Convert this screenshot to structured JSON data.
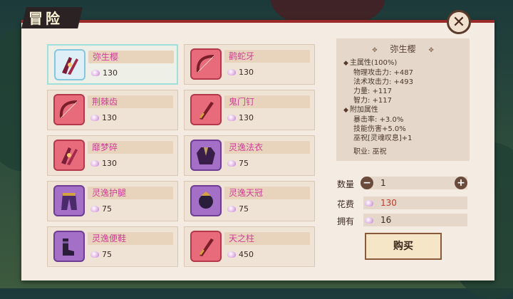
{
  "header": {
    "title": "冒险"
  },
  "items": [
    {
      "name": "弥生樱",
      "price": "130",
      "icon": "claws-icon",
      "style": "cyan",
      "selected": true
    },
    {
      "name": "鹳蛇牙",
      "price": "130",
      "icon": "bow-icon",
      "style": "red",
      "selected": false
    },
    {
      "name": "荆棘齿",
      "price": "130",
      "icon": "bow-icon",
      "style": "red",
      "selected": false
    },
    {
      "name": "鬼门钉",
      "price": "130",
      "icon": "blade-icon",
      "style": "red",
      "selected": false
    },
    {
      "name": "靡梦碎",
      "price": "130",
      "icon": "claws-icon",
      "style": "red",
      "selected": false
    },
    {
      "name": "灵逸法衣",
      "price": "75",
      "icon": "robe-icon",
      "style": "purple",
      "selected": false
    },
    {
      "name": "灵逸护腿",
      "price": "75",
      "icon": "pants-icon",
      "style": "purple",
      "selected": false
    },
    {
      "name": "灵逸天冠",
      "price": "75",
      "icon": "crown-icon",
      "style": "purple",
      "selected": false
    },
    {
      "name": "灵逸便鞋",
      "price": "75",
      "icon": "boots-icon",
      "style": "purple",
      "selected": false
    },
    {
      "name": "天之柱",
      "price": "450",
      "icon": "blade-icon",
      "style": "red",
      "selected": false
    }
  ],
  "detail": {
    "title": "弥生樱",
    "main_attr_header": "主属性(100%)",
    "main_attrs": [
      "物理攻击力: +487",
      "法术攻击力: +493",
      "力量: +117",
      "智力: +117"
    ],
    "extra_attr_header": "附加属性",
    "extra_attrs": [
      "暴击率: +3.0%",
      "技能伤害+5.0%",
      "巫祝[灵魂叹息]+1"
    ],
    "profession": "职业: 巫祝"
  },
  "purchase": {
    "qty_label": "数量",
    "qty_value": "1",
    "cost_label": "花费",
    "cost_value": "130",
    "own_label": "拥有",
    "own_value": "16",
    "buy_label": "购买"
  },
  "colors": {
    "accent_red": "#9c2a2a",
    "item_name": "#d03e98",
    "cost_red": "#c0392b"
  }
}
